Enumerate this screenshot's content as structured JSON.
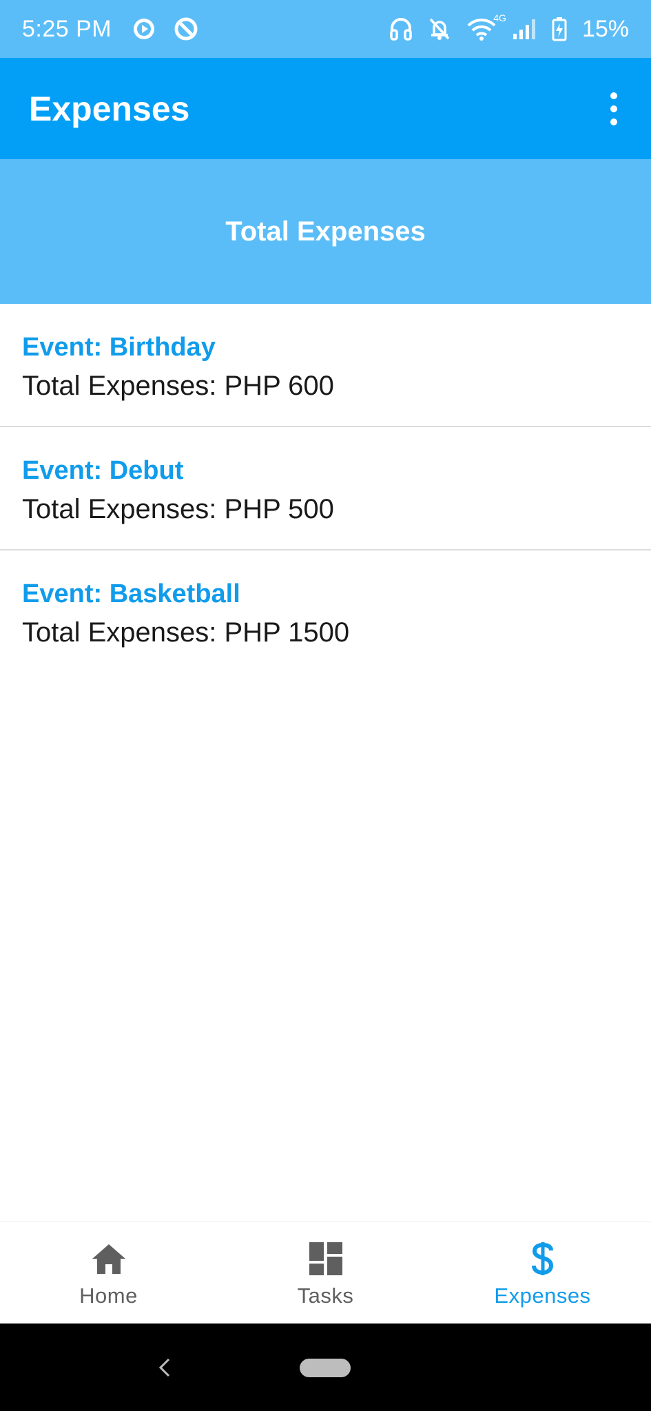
{
  "status_bar": {
    "time": "5:25 PM",
    "battery": "15%",
    "network": "4G",
    "left_icons": [
      "media-play-icon",
      "sync-icon"
    ],
    "right_icons": [
      "headset-icon",
      "bell-off-icon",
      "wifi-icon",
      "signal-icon",
      "battery-charging-icon"
    ]
  },
  "app_bar": {
    "title": "Expenses",
    "menu_icon": "more-vert-icon"
  },
  "header": {
    "title": "Total Expenses"
  },
  "expenses": [
    {
      "event": "Event: Birthday",
      "total": "Total Expenses: PHP 600"
    },
    {
      "event": "Event: Debut",
      "total": "Total Expenses: PHP 500"
    },
    {
      "event": "Event: Basketball",
      "total": "Total Expenses: PHP 1500"
    }
  ],
  "bottom_nav": {
    "items": [
      {
        "label": "Home",
        "icon": "home-icon",
        "active": false
      },
      {
        "label": "Tasks",
        "icon": "dashboard-icon",
        "active": false
      },
      {
        "label": "Expenses",
        "icon": "dollar-icon",
        "active": true
      }
    ]
  },
  "colors": {
    "status_bar": "#5BBDF7",
    "app_bar": "#039FF6",
    "accent": "#109CEB",
    "nav_inactive": "#5f5f5f"
  }
}
